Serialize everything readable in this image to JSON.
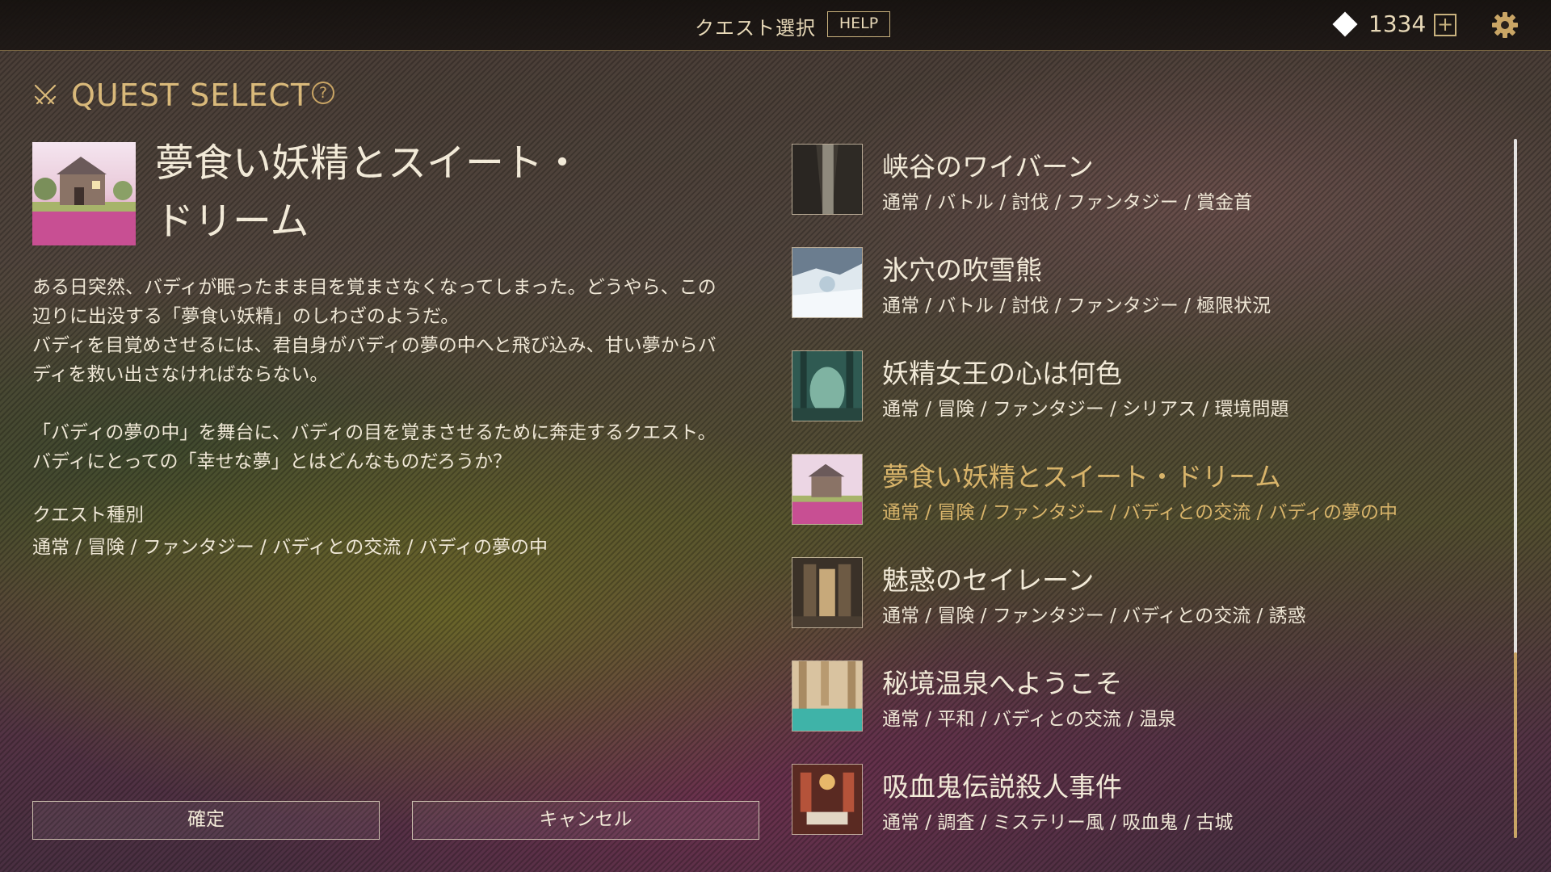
{
  "header": {
    "title": "クエスト選択",
    "help_label": "HELP",
    "gem_count": "1334",
    "plus_label": "+"
  },
  "section": {
    "label": "QUEST SELECT",
    "help_icon": "?"
  },
  "detail": {
    "title_line1": "夢食い妖精とスイート・",
    "title_line2": "ドリーム",
    "desc_p1_line1": "ある日突然、バディが眠ったまま目を覚まさなくなってしまった。どうやら、この",
    "desc_p1_line2": "辺りに出没する「夢食い妖精」のしわざのようだ。",
    "desc_p1_line3": "バディを目覚めさせるには、君自身がバディの夢の中へと飛び込み、甘い夢からバ",
    "desc_p1_line4": "ディを救い出さなければならない。",
    "desc_p2_line1": "「バディの夢の中」を舞台に、バディの目を覚まさせるために奔走するクエスト。",
    "desc_p2_line2": "バディにとっての「幸せな夢」とはどんなものだろうか？",
    "type_label": "クエスト種別",
    "type_tags": "通常 / 冒険 / ファンタジー / バディとの交流 / バディの夢の中"
  },
  "buttons": {
    "confirm": "確定",
    "cancel": "キャンセル"
  },
  "quests": [
    {
      "name": "峡谷のワイバーン",
      "tags": "通常 / バトル / 討伐 / ファンタジー / 賞金首",
      "thumb_icon": "canyon-thumbnail",
      "selected": false
    },
    {
      "name": "氷穴の吹雪熊",
      "tags": "通常 / バトル / 討伐 / ファンタジー / 極限状況",
      "thumb_icon": "ice-cave-thumbnail",
      "selected": false
    },
    {
      "name": "妖精女王の心は何色",
      "tags": "通常 / 冒険 / ファンタジー / シリアス / 環境問題",
      "thumb_icon": "forest-thumbnail",
      "selected": false
    },
    {
      "name": "夢食い妖精とスイート・ドリーム",
      "tags": "通常 / 冒険 / ファンタジー / バディとの交流 / バディの夢の中",
      "thumb_icon": "cottage-thumbnail",
      "selected": true
    },
    {
      "name": "魅惑のセイレーン",
      "tags": "通常 / 冒険 / ファンタジー / バディとの交流 / 誘惑",
      "thumb_icon": "corridor-thumbnail",
      "selected": false
    },
    {
      "name": "秘境温泉へようこそ",
      "tags": "通常 / 平和 / バディとの交流 / 温泉",
      "thumb_icon": "hot-spring-thumbnail",
      "selected": false
    },
    {
      "name": "吸血鬼伝説殺人事件",
      "tags": "通常 / 調査 / ミステリー風 / 吸血鬼 / 古城",
      "thumb_icon": "castle-hall-thumbnail",
      "selected": false
    }
  ],
  "colors": {
    "accent_gold": "#d8b46a",
    "text_main": "#efe7d6",
    "topbar_bg": "#1a1512"
  }
}
